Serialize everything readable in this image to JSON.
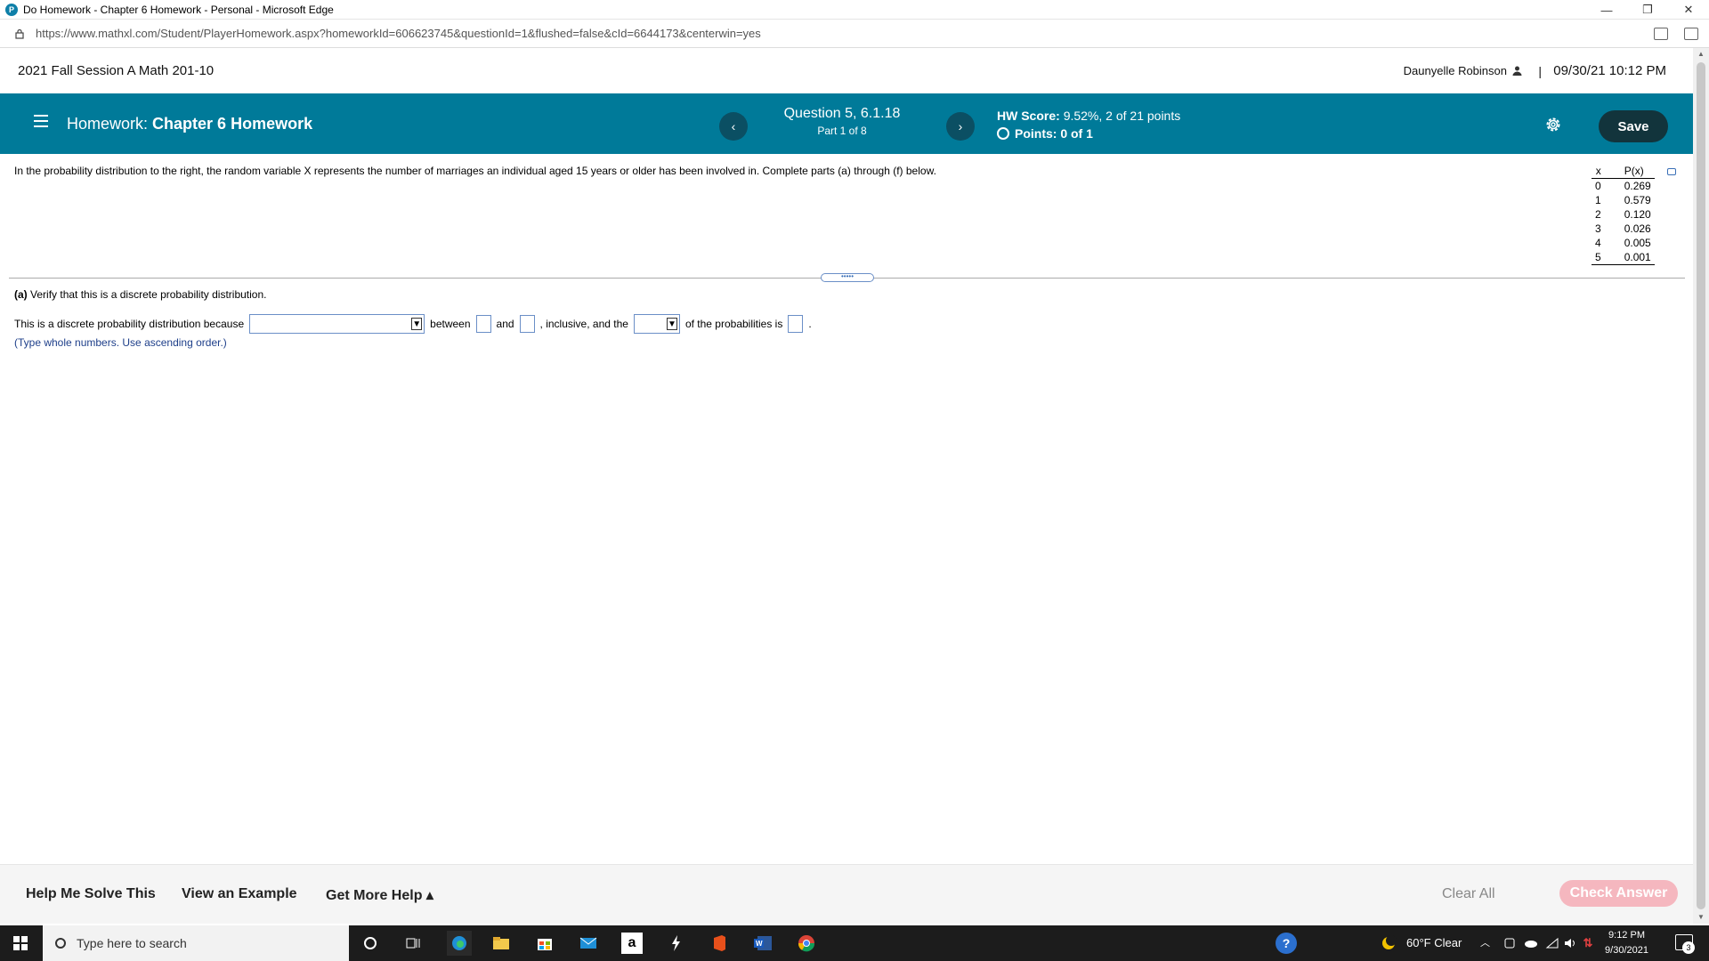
{
  "window": {
    "title": "Do Homework - Chapter 6 Homework - Personal - Microsoft Edge",
    "minimize": "—",
    "restore": "❐",
    "close": "✕"
  },
  "browser": {
    "url": "https://www.mathxl.com/Student/PlayerHomework.aspx?homeworkId=606623745&questionId=1&flushed=false&cId=6644173&centerwin=yes"
  },
  "course": {
    "name": "2021 Fall Session A Math 201-10",
    "user": "Daunyelle Robinson",
    "separator": "|",
    "datetime": "09/30/21 10:12 PM"
  },
  "homework": {
    "label": "Homework:",
    "name": "Chapter 6 Homework",
    "prev": "‹",
    "next": "›",
    "question": "Question 5, 6.1.18",
    "part": "Part 1 of 8",
    "hw_score_label": "HW Score:",
    "hw_score_value": "9.52%, 2 of 21 points",
    "points": "Points: 0 of 1",
    "save": "Save"
  },
  "question": {
    "text": "In the probability distribution to the right, the random variable X represents the number of marriages an individual aged 15 years or older has been involved in. Complete parts (a) through (f) below.",
    "table": {
      "headers": [
        "x",
        "P(x)"
      ],
      "rows": [
        [
          "0",
          "0.269"
        ],
        [
          "1",
          "0.579"
        ],
        [
          "2",
          "0.120"
        ],
        [
          "3",
          "0.026"
        ],
        [
          "4",
          "0.005"
        ],
        [
          "5",
          "0.001"
        ]
      ]
    },
    "grip": "•••••",
    "part_a_label": "(a)",
    "part_a_text": "Verify that this is a discrete probability distribution.",
    "answer_prefix": "This is a discrete probability distribution because",
    "between": "between",
    "and": "and",
    "inclusive": ", inclusive, and the",
    "of_probs": "of the probabilities is",
    "period": ".",
    "hint": "(Type whole numbers. Use ascending order.)"
  },
  "footer": {
    "help_solve": "Help Me Solve This",
    "view_example": "View an Example",
    "more_help": "Get More Help ▴",
    "clear_all": "Clear All",
    "check_answer": "Check Answer"
  },
  "taskbar": {
    "search_placeholder": "Type here to search",
    "weather": "60°F  Clear",
    "time": "9:12 PM",
    "date": "9/30/2021",
    "notifications": "3"
  }
}
